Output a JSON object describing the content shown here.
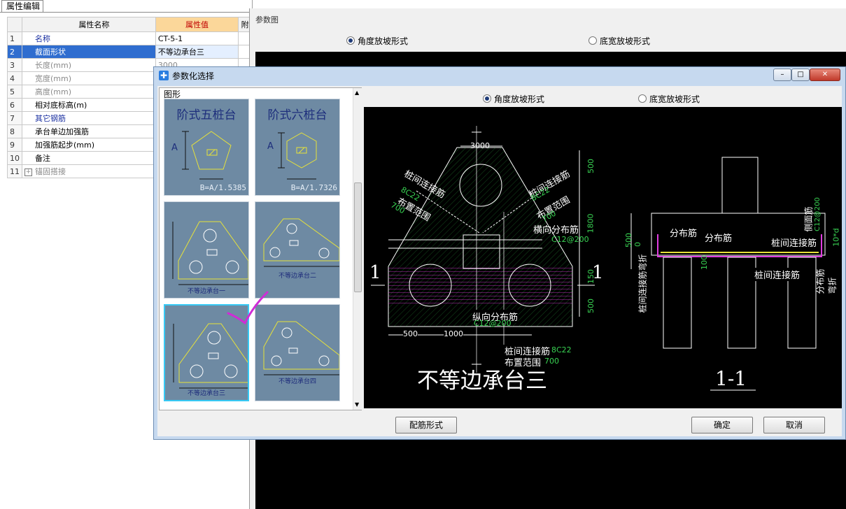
{
  "prop_editor": {
    "tab_label": "属性编辑",
    "col_name": "属性名称",
    "col_value": "属性值",
    "col_extra": "附",
    "rows": [
      {
        "no": "1",
        "name": "名称",
        "value": "CT-5-1"
      },
      {
        "no": "2",
        "name": "截面形状",
        "value": "不等边承台三"
      },
      {
        "no": "3",
        "name": "长度(mm)",
        "value": "3000"
      },
      {
        "no": "4",
        "name": "宽度(mm)",
        "value": ""
      },
      {
        "no": "5",
        "name": "高度(mm)",
        "value": ""
      },
      {
        "no": "6",
        "name": "相对底标高(m)",
        "value": ""
      },
      {
        "no": "7",
        "name": "其它钢筋",
        "value": ""
      },
      {
        "no": "8",
        "name": "承台单边加强筋",
        "value": ""
      },
      {
        "no": "9",
        "name": "加强筋起步(mm)",
        "value": ""
      },
      {
        "no": "10",
        "name": "备注",
        "value": ""
      },
      {
        "no": "11",
        "name": "锚固搭接",
        "value": "",
        "expander": "+"
      }
    ]
  },
  "bg_window": {
    "title": "参数图",
    "radio_angle": "角度放坡形式",
    "radio_width": "底宽放坡形式"
  },
  "dialog": {
    "title": "参数化选择",
    "window_buttons": {
      "min": "–",
      "max": "□",
      "close": "✕"
    },
    "gallery_label": "图形",
    "thumbnails": [
      {
        "title": "阶式五桩台",
        "formula": "B=A/1.5385",
        "label_a": "A"
      },
      {
        "title": "阶式六桩台",
        "formula": "B=A/1.7326",
        "label_a": "A"
      },
      {
        "caption": "不等边承台一"
      },
      {
        "caption": "不等边承台二"
      },
      {
        "caption": "不等边承台三",
        "selected": true
      },
      {
        "caption": "不等边承台四"
      }
    ],
    "radio_angle": "角度放坡形式",
    "radio_width": "底宽放坡形式",
    "rebar_button": "配筋形式",
    "ok_button": "确定",
    "cancel_button": "取消"
  },
  "drawing": {
    "dim_top": "3000",
    "dim_500_a": "500",
    "dim_1800": "1800",
    "dim_150": "150",
    "dim_500_b": "500",
    "dim_bottom_500": "500",
    "dim_bottom_1000": "1000",
    "label_pile_conn_left": "桩间连接筋",
    "label_pile_conn_left_spec": "8C22",
    "label_range_left": "布置范围",
    "label_range_left_val": "700",
    "label_pile_conn_right": "桩间连接筋",
    "label_pile_conn_right_spec": "8C22",
    "label_range_right": "布置范围",
    "label_range_right_val": "700",
    "label_transverse": "横向分布筋",
    "label_transverse_spec": "C12@200",
    "label_longitudinal": "纵向分布筋",
    "label_longitudinal_spec": "C12@200",
    "label_pile_conn_bottom": "桩间连接筋",
    "label_pile_conn_bottom_spec": "8C22",
    "label_range_bottom": "布置范围",
    "label_range_bottom_val": "700",
    "section_mark": "1",
    "plan_title": "不等边承台三",
    "section_title": "1-1",
    "sec_dist1": "分布筋",
    "sec_dist2": "分布筋",
    "sec_pile_conn": "桩间连接筋",
    "sec_side": "侧面筋",
    "sec_side_spec": "C12@200",
    "sec_pile_conn_bottom": "桩间连接筋",
    "sec_pile_bend": "桩间连接筋弯折",
    "sec_dist_bend": "分布筋弯折",
    "sec_10d": "10*d",
    "sec_500": "500",
    "sec_0": "0",
    "sec_100": "100"
  },
  "colors": {
    "selection_blue": "#2f6dcf",
    "header_orange": "#fbd79a",
    "thumb_bg": "#6e8aa3",
    "cad_green": "#39d353",
    "cad_magenta": "#e03ce0",
    "cad_yellow": "#e7e23a",
    "check_magenta": "#d02bd6"
  }
}
